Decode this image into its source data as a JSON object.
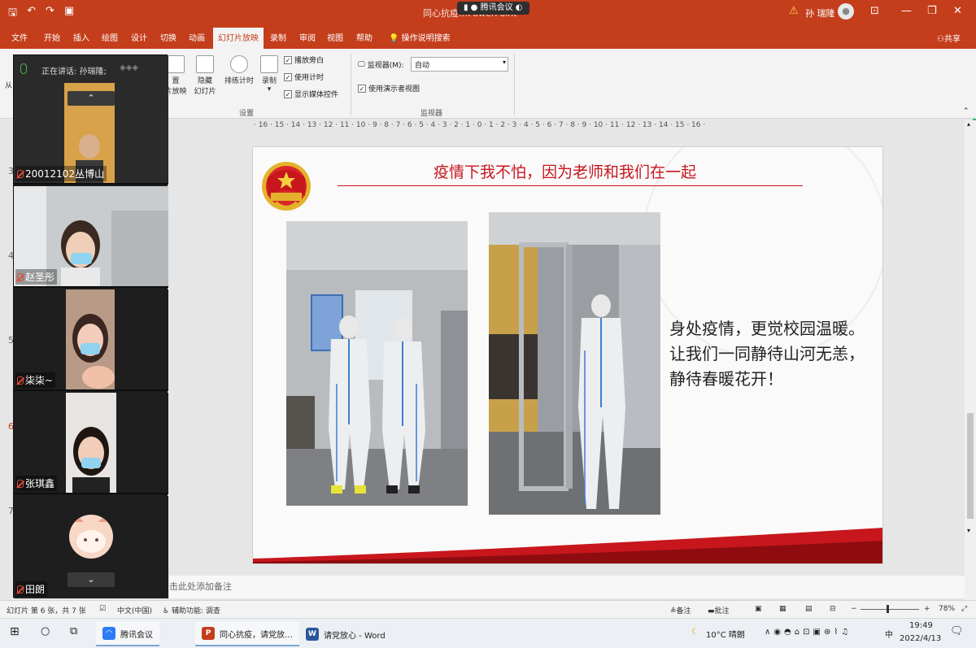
{
  "titlebar": {
    "doc_title": "同心抗疫…PowerPoint",
    "meeting_label": "腾讯会议",
    "user_name": "孙 瑞隆",
    "icons": [
      "save-icon",
      "undo-icon",
      "redo-icon",
      "present-icon"
    ]
  },
  "menubar": {
    "tabs": [
      "文件",
      "开始",
      "插入",
      "绘图",
      "设计",
      "切换",
      "动画",
      "幻灯片放映",
      "录制",
      "审阅",
      "视图",
      "帮助"
    ],
    "active_tab": "幻灯片放映",
    "search": "操作说明搜索",
    "share": "共享"
  },
  "ribbon": {
    "hide_label_1": "置",
    "hide_label_2": "片放映",
    "hide_slide": "隐藏",
    "hide_slide_2": "幻灯片",
    "rehearse": "排练计时",
    "record": "录制",
    "play_narration": "播放旁白",
    "use_timing": "使用计时",
    "show_media": "显示媒体控件",
    "group_setup": "设置",
    "monitor_label": "监视器(M):",
    "monitor_value": "自动",
    "presenter_view": "使用演示者视图",
    "group_monitor": "监视器",
    "from_label": "从"
  },
  "thumbs": [
    "3",
    "4",
    "5",
    "6",
    "7"
  ],
  "ruler": "· 16 · 15 · 14 · 13 · 12 · 11 · 10 · 9 · 8 · 7 · 6 · 5 · 4 · 3 · 2 · 1 · 0 · 1 · 2 · 3 · 4 · 5 · 6 · 7 · 8 · 9 · 10 · 11 · 12 · 13 · 14 · 15 · 16 ·",
  "slide": {
    "title": "疫情下我不怕，因为老师和我们在一起",
    "body": [
      "身处疫情，更觉校园温暖。",
      "让我们一同静待山河无恙，",
      "静待春暖花开！"
    ]
  },
  "notes_placeholder": "击此处添加备注",
  "video_panel": {
    "speaking_label": "正在讲话: 孙瑞隆;",
    "participants": [
      "20012102丛博山",
      "赵圣彤",
      "柒柒~",
      "张琪鑫",
      "田朗"
    ]
  },
  "statusbar": {
    "slide_count": "幻灯片 第 6 张，共 7 张",
    "language": "中文(中国)",
    "accessibility": "辅助功能: 调查",
    "notes": "备注",
    "comments": "批注",
    "zoom": "78%"
  },
  "taskbar": {
    "apps": [
      "腾讯会议",
      "同心抗疫，请党放…",
      "请党放心 - Word"
    ],
    "weather": "10°C 晴朗",
    "ime": "中",
    "time": "19:49",
    "date": "2022/4/13"
  },
  "colors": {
    "ppt_red": "#c43e1c",
    "slide_red": "#c8161d",
    "frame_green": "#29c26a"
  }
}
